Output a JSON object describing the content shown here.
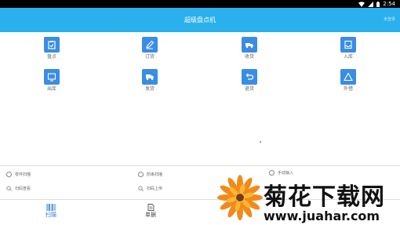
{
  "status_bar": {
    "time": "2:54"
  },
  "header": {
    "title": "超级盘点机",
    "right_label": "未登录"
  },
  "grid": [
    {
      "label": "盘点",
      "icon": "clipboard-icon"
    },
    {
      "label": "订货",
      "icon": "pencil-icon"
    },
    {
      "label": "收货",
      "icon": "truck-icon"
    },
    {
      "label": "入库",
      "icon": "inbox-icon"
    },
    {
      "label": "出库",
      "icon": "outbox-icon"
    },
    {
      "label": "发货",
      "icon": "delivery-truck-icon"
    },
    {
      "label": "退货",
      "icon": "return-icon"
    },
    {
      "label": "外借",
      "icon": "triangle-icon"
    }
  ],
  "options": [
    {
      "label": "零件扫描"
    },
    {
      "label": "防串扫描"
    },
    {
      "label": "手动输入"
    },
    {
      "label": "扫码查看"
    },
    {
      "label": "扫码上传"
    }
  ],
  "tabs": [
    {
      "label": "扫描",
      "icon": "barcode-icon"
    },
    {
      "label": "单据",
      "icon": "document-icon"
    }
  ],
  "colors": {
    "header": "#2ab0ec",
    "icon_tile": "#3a8de4",
    "active_tab": "#2a7fd0"
  },
  "watermark": {
    "brand": "菊花下载网",
    "url": "www.juahar.com"
  }
}
